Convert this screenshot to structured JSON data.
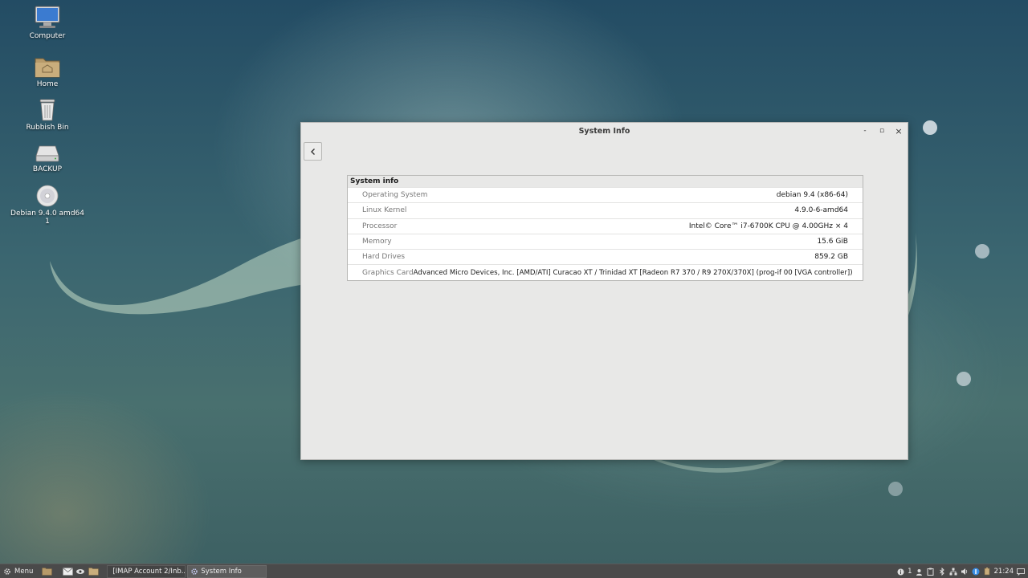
{
  "desktop": {
    "icons": [
      {
        "label": "Computer",
        "icon": "computer-icon"
      },
      {
        "label": "Home",
        "icon": "home-folder-icon"
      },
      {
        "label": "Rubbish Bin",
        "icon": "trash-icon"
      },
      {
        "label": "BACKUP",
        "icon": "drive-icon"
      },
      {
        "label": "Debian 9.4.0 amd64 1",
        "icon": "disc-icon"
      }
    ]
  },
  "window": {
    "title": "System Info",
    "controls": {
      "minimize": "-",
      "maximize": "▫",
      "close": "×"
    },
    "back_icon": "chevron-left-icon",
    "section_title": "System info",
    "rows": [
      {
        "label": "Operating System",
        "value": "debian 9.4 (x86-64)"
      },
      {
        "label": "Linux Kernel",
        "value": "4.9.0-6-amd64"
      },
      {
        "label": "Processor",
        "value": "Intel© Core™ i7-6700K CPU @ 4.00GHz × 4"
      },
      {
        "label": "Memory",
        "value": "15.6 GiB"
      },
      {
        "label": "Hard Drives",
        "value": "859.2 GB"
      },
      {
        "label": "Graphics Card",
        "value": "Advanced Micro Devices, Inc. [AMD/ATI] Curacao XT / Trinidad XT [Radeon R7 370 / R9 270X/370X] (prog-if 00 [VGA controller])"
      }
    ]
  },
  "taskbar": {
    "menu_label": "Menu",
    "tasks": [
      {
        "label": "[IMAP Account 2/Inb...",
        "active": false
      },
      {
        "label": "System Info",
        "active": true
      }
    ],
    "tray": {
      "notification_count": "1",
      "clock": "21:24"
    }
  },
  "colors": {
    "window_bg": "#e8e8e7",
    "taskbar_bg": "#4a4a4a",
    "update_icon": "#3a8ee6"
  }
}
